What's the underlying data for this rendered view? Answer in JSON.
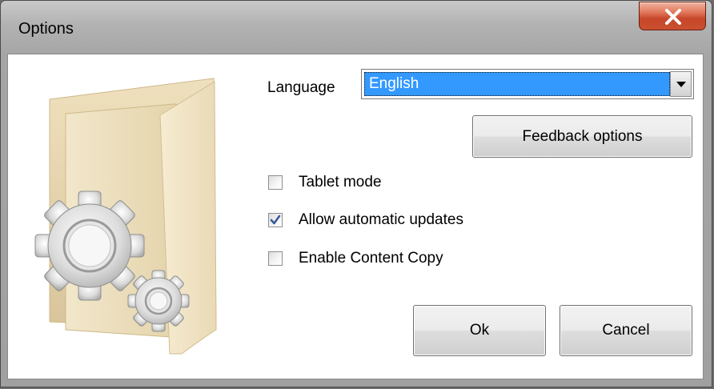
{
  "window": {
    "title": "Options",
    "close_icon": "close-x-icon"
  },
  "language": {
    "label": "Language",
    "selected": "English",
    "dropdown_icon": "chevron-down-icon"
  },
  "buttons": {
    "feedback": "Feedback options",
    "ok": "Ok",
    "cancel": "Cancel"
  },
  "checkboxes": [
    {
      "label": "Tablet mode",
      "checked": false
    },
    {
      "label": "Allow automatic updates",
      "checked": true
    },
    {
      "label": "Enable Content Copy",
      "checked": false
    }
  ],
  "illustration": {
    "icon": "folder-settings-icon"
  },
  "colors": {
    "selection": "#3399ff",
    "close_button": "#c7462a",
    "check_mark": "#3a5a98"
  }
}
